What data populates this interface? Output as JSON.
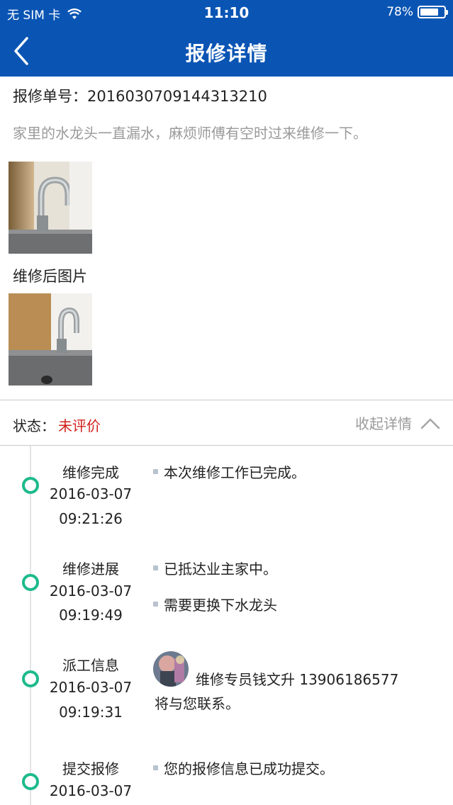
{
  "status_bar": {
    "carrier": "无 SIM 卡",
    "time": "11:10",
    "battery": "78%",
    "battery_level": 0.78
  },
  "nav": {
    "title": "报修详情",
    "back_icon": "chevron-left-icon"
  },
  "order": {
    "label": "报修单号：",
    "number": "2016030709144313210"
  },
  "description": "家里的水龙头一直漏水，麻烦师傅有空时过来维修一下。",
  "after_photos_label": "维修后图片",
  "status": {
    "label": "状态：",
    "value": "未评价",
    "value_color": "#d0201a",
    "collapse_label": "收起详情",
    "collapse_icon": "chevron-up-icon"
  },
  "timeline": [
    {
      "title": "维修完成",
      "date": "2016-03-07",
      "time": "09:21:26",
      "notes": [
        "本次维修工作已完成。"
      ]
    },
    {
      "title": "维修进展",
      "date": "2016-03-07",
      "time": "09:19:49",
      "notes": [
        "已抵达业主家中。",
        "需要更换下水龙头"
      ]
    },
    {
      "title": "派工信息",
      "date": "2016-03-07",
      "time": "09:19:31",
      "assign_line1": "维修专员钱文升 13906186577",
      "assign_line2": "将与您联系。"
    },
    {
      "title": "提交报修",
      "date": "2016-03-07",
      "notes": [
        "您的报修信息已成功提交。"
      ]
    }
  ],
  "colors": {
    "brand": "#0a55b4",
    "timeline_dot": "#1dba8c"
  }
}
